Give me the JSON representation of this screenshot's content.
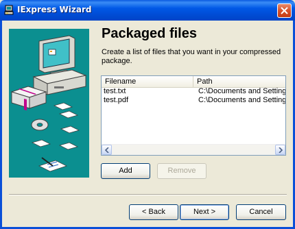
{
  "window": {
    "title": "IExpress Wizard",
    "icons": {
      "app": "iexpress-app-icon",
      "close": "close-icon"
    },
    "colors": {
      "titlebar": "#0054e3",
      "close": "#d8522a",
      "panel": "#0b8f90",
      "face": "#ece9d8"
    }
  },
  "page": {
    "heading": "Packaged files",
    "description": "Create a list of files that you want in your compressed package."
  },
  "file_list": {
    "columns": [
      "Filename",
      "Path"
    ],
    "rows": [
      {
        "filename": "test.txt",
        "path": "C:\\Documents and Settings"
      },
      {
        "filename": "test.pdf",
        "path": "C:\\Documents and Settings"
      }
    ]
  },
  "buttons": {
    "add": "Add",
    "remove": "Remove",
    "back": "< Back",
    "next": "Next >",
    "cancel": "Cancel"
  }
}
